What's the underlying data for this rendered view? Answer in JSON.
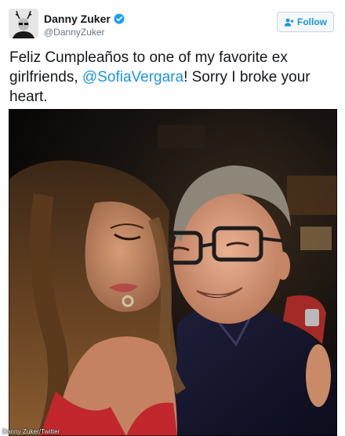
{
  "user": {
    "name": "Danny Zuker",
    "handle": "@DannyZuker",
    "verified": true
  },
  "follow_button": {
    "label": "Follow",
    "icon": "add-user-icon"
  },
  "tweet": {
    "text_before": "Feliz Cumpleaños to one of my favorite ex girlfriends, ",
    "mention": "@SofiaVergara",
    "text_after": "! Sorry I broke your heart."
  },
  "photo": {
    "credit": "Danny Zuker/Twitter"
  },
  "colors": {
    "link": "#1b95e0",
    "verified": "#1da1f2",
    "text": "#14171a",
    "secondary": "#657786"
  }
}
